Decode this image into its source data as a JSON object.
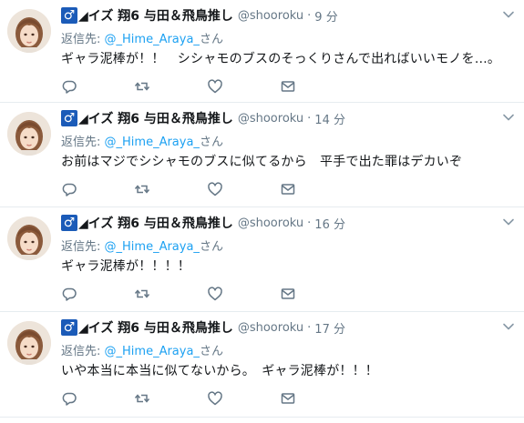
{
  "tweets": [
    {
      "verified_badge": "♂",
      "display_name": "◢イズ 翔6 与田＆飛鳥推し",
      "username": "@shooroku",
      "separator": "·",
      "time": "9 分",
      "reply_prefix": "返信先: ",
      "reply_handle": "@_Hime_Araya_",
      "reply_suffix": "さん",
      "text": "ギャラ泥棒が！！　シシャモのブスのそっくりさんで出ればいいモノを…。"
    },
    {
      "verified_badge": "♂",
      "display_name": "◢イズ 翔6 与田＆飛鳥推し",
      "username": "@shooroku",
      "separator": "·",
      "time": "14 分",
      "reply_prefix": "返信先: ",
      "reply_handle": "@_Hime_Araya_",
      "reply_suffix": "さん",
      "text": "お前はマジでシシャモのブスに似てるから　平手で出た罪はデカいぞ"
    },
    {
      "verified_badge": "♂",
      "display_name": "◢イズ 翔6 与田＆飛鳥推し",
      "username": "@shooroku",
      "separator": "·",
      "time": "16 分",
      "reply_prefix": "返信先: ",
      "reply_handle": "@_Hime_Araya_",
      "reply_suffix": "さん",
      "text": "ギャラ泥棒が！！！！"
    },
    {
      "verified_badge": "♂",
      "display_name": "◢イズ 翔6 与田＆飛鳥推し",
      "username": "@shooroku",
      "separator": "·",
      "time": "17 分",
      "reply_prefix": "返信先: ",
      "reply_handle": "@_Hime_Araya_",
      "reply_suffix": "さん",
      "text": "いや本当に本当に似てないから。　ギャラ泥棒が！！！"
    }
  ],
  "icons": {
    "reply": "reply-icon",
    "retweet": "retweet-icon",
    "like": "heart-icon",
    "dm": "envelope-icon",
    "menu": "chevron-down-icon"
  },
  "colors": {
    "link": "#1da1f2",
    "muted": "#657786",
    "text": "#14171a",
    "badge": "#1b5bb8",
    "divider": "#e6ecf0"
  }
}
